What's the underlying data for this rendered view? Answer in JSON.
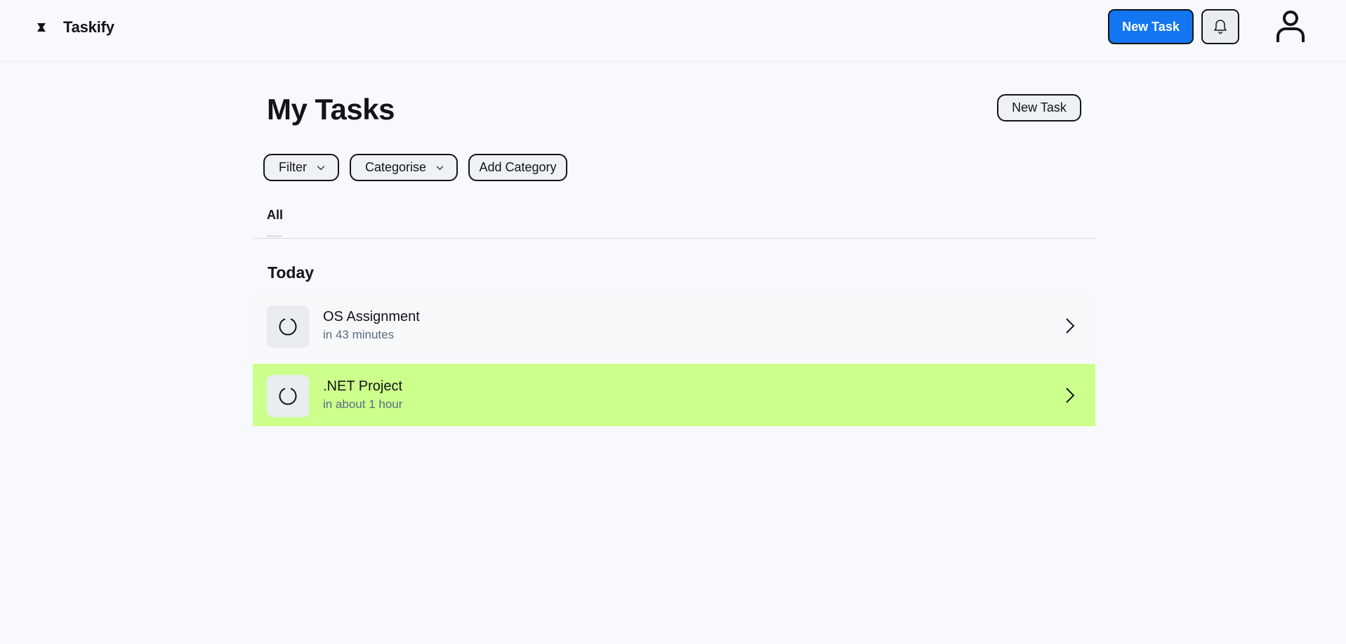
{
  "app": {
    "name": "Taskify"
  },
  "header": {
    "new_task_label": "New Task",
    "bell_icon": "bell-icon",
    "avatar_icon": "user-icon"
  },
  "main": {
    "title": "My Tasks",
    "new_task_label": "New Task",
    "toolbar": {
      "filter_label": "Filter",
      "categorise_label": "Categorise",
      "add_category_label": "Add Category"
    },
    "tabs": [
      {
        "label": "All",
        "active": true
      }
    ],
    "sections": [
      {
        "title": "Today",
        "tasks": [
          {
            "title": "OS Assignment",
            "due": "in 43 minutes",
            "highlighted": false
          },
          {
            "title": ".NET Project",
            "due": "in about 1 hour",
            "highlighted": true
          }
        ]
      }
    ]
  },
  "colors": {
    "primary": "#1276f0",
    "highlight": "#ccff8c",
    "background": "#f7f9fc",
    "muted_text": "#5b6b80"
  }
}
